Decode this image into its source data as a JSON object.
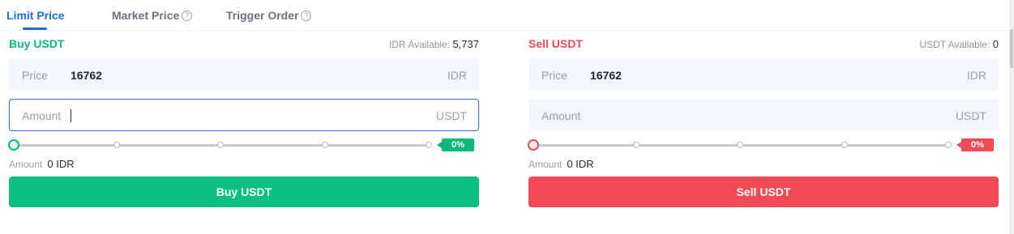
{
  "tabs": [
    {
      "label": "Limit Price",
      "active": true,
      "help": false
    },
    {
      "label": "Market Price",
      "active": false,
      "help": true
    },
    {
      "label": "Trigger Order",
      "active": false,
      "help": true
    }
  ],
  "help_glyph": "?",
  "buy": {
    "title": "Buy USDT",
    "available_label": "IDR Available:",
    "available_value": "5,737",
    "price_label": "Price",
    "price_value": "16762",
    "price_unit": "IDR",
    "amount_label": "Amount",
    "amount_value": "",
    "amount_unit": "USDT",
    "slider_percent": "0%",
    "total_label": "Amount",
    "total_value": "0 IDR",
    "button_label": "Buy USDT"
  },
  "sell": {
    "title": "Sell USDT",
    "available_label": "USDT Available:",
    "available_value": "0",
    "price_label": "Price",
    "price_value": "16762",
    "price_unit": "IDR",
    "amount_label": "Amount",
    "amount_value": "",
    "amount_unit": "USDT",
    "slider_percent": "0%",
    "total_label": "Amount",
    "total_value": "0 IDR",
    "button_label": "Sell USDT"
  },
  "colors": {
    "accent": "#1f6fd6",
    "buy": "#0fb77a",
    "sell": "#ef4a55"
  }
}
